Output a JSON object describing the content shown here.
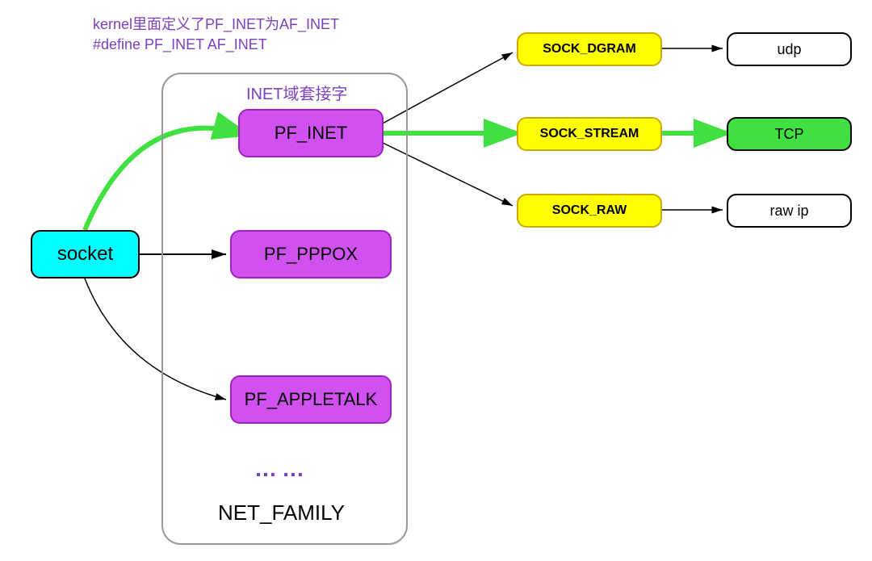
{
  "annotation": {
    "line1": "kernel里面定义了PF_INET为AF_INET",
    "line2": "#define PF_INET  AF_INET"
  },
  "socket": {
    "label": "socket"
  },
  "inet_label": "INET域套接字",
  "families": {
    "pf_inet": "PF_INET",
    "pf_pppox": "PF_PPPOX",
    "pf_appletalk": "PF_APPLETALK"
  },
  "dots": "……",
  "net_family": "NET_FAMILY",
  "socks": {
    "dgram": "SOCK_DGRAM",
    "stream": "SOCK_STREAM",
    "raw": "SOCK_RAW"
  },
  "protos": {
    "udp": "udp",
    "tcp": "TCP",
    "rawip": "raw ip"
  }
}
